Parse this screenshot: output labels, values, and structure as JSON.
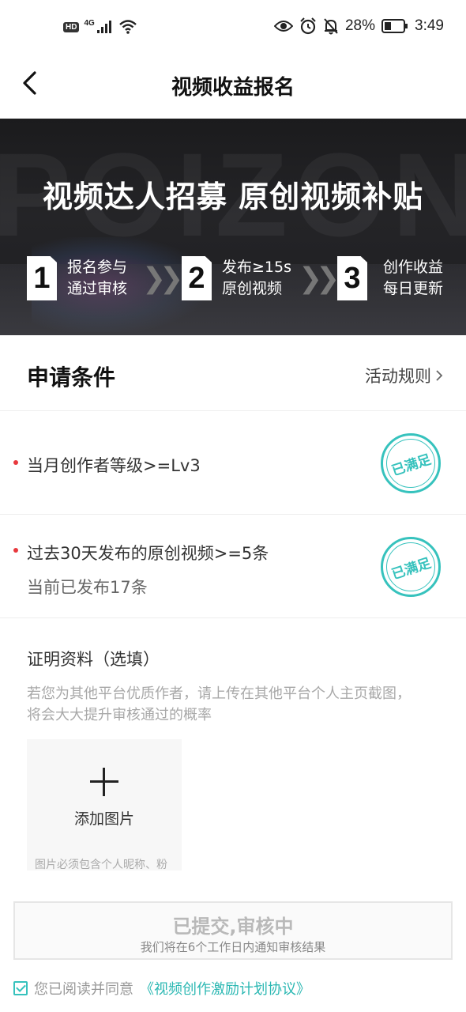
{
  "status_bar": {
    "hd": "HD",
    "network": "4G",
    "battery": "28%",
    "time": "3:49"
  },
  "nav": {
    "title": "视频收益报名"
  },
  "banner": {
    "bg_text": "POIZON",
    "title": "视频达人招募 原创视频补贴",
    "steps": [
      {
        "num": "1",
        "line1": "报名参与",
        "line2": "通过审核"
      },
      {
        "num": "2",
        "line1": "发布≥15s",
        "line2": "原创视频"
      },
      {
        "num": "3",
        "line1": "创作收益",
        "line2": "每日更新"
      }
    ]
  },
  "conditions": {
    "title": "申请条件",
    "rules_link": "活动规则",
    "items": [
      {
        "text": "当月创作者等级>=Lv3",
        "sub": "",
        "status": "已满足"
      },
      {
        "text": "过去30天发布的原创视频>=5条",
        "sub": "当前已发布17条",
        "status": "已满足"
      }
    ]
  },
  "proof": {
    "title": "证明资料（选填）",
    "description": "若您为其他平台优质作者，请上传在其他平台个人主页截图，将会大大提升审核通过的概率",
    "upload_label": "添加图片",
    "upload_note": "图片必须包含个人昵称、粉"
  },
  "submit": {
    "main": "已提交,审核中",
    "sub": "我们将在6个工作日内通知审核结果"
  },
  "agreement": {
    "text": "您已阅读并同意",
    "link": "《视频创作激励计划协议》",
    "checked": true
  },
  "colors": {
    "accent": "#36c2bd",
    "dot": "#e8383d"
  }
}
